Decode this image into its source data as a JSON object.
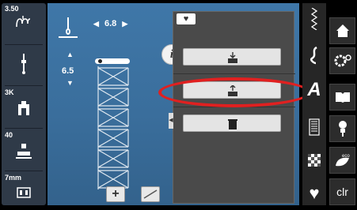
{
  "left_column": {
    "tiles": [
      {
        "name": "upper-thread-tension",
        "number": "3.50",
        "icon": "thread-tension-icon"
      },
      {
        "name": "needle-position",
        "number": "",
        "icon": "needle-icon"
      },
      {
        "name": "presser-foot",
        "number": "3K",
        "icon": "presser-foot-icon"
      },
      {
        "name": "presser-foot-pressure",
        "number": "40",
        "icon": "foot-pressure-icon"
      },
      {
        "name": "feed-dog",
        "number": "7mm",
        "icon": "feed-dog-icon"
      }
    ]
  },
  "main": {
    "stitch_width": "6.8",
    "stitch_length": "6.5",
    "info_label": "i"
  },
  "memory_panel": {
    "tab_icon": "heart-icon",
    "buttons": [
      {
        "name": "memory-save-button",
        "icon": "save-to-memory-icon"
      },
      {
        "name": "memory-load-button",
        "icon": "load-from-memory-icon",
        "highlighted": true
      },
      {
        "name": "memory-delete-button",
        "icon": "trash-icon"
      }
    ]
  },
  "category_strip": {
    "items": [
      "practical-stitches-icon",
      "decorative-stitches-icon",
      "A",
      "buttonhole-icon",
      "quilt-stitches-icon",
      "memory-heart-icon"
    ]
  },
  "right_column": {
    "buttons": [
      {
        "name": "home-button",
        "icon": "home-icon"
      },
      {
        "name": "setup-button",
        "icon": "settings-icon"
      },
      {
        "name": "tutorial-button",
        "icon": "book-icon"
      },
      {
        "name": "advisor-button",
        "icon": "dress-form-icon"
      },
      {
        "name": "eco-button",
        "icon": "eco-icon",
        "label": "eco"
      },
      {
        "name": "clear-button",
        "label": "clr"
      }
    ]
  },
  "colors": {
    "main_blue": "#3f77a8",
    "highlight_ring": "#e02020",
    "panel_gray": "#4a4a4a"
  }
}
